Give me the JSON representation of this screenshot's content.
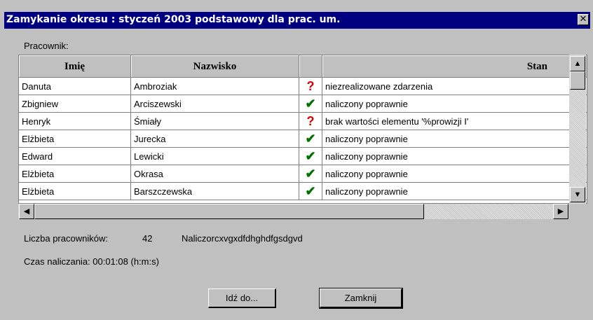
{
  "window": {
    "title": "Zamykanie okresu : styczeń 2003 podstawowy dla prac. um.",
    "close_glyph": "✕"
  },
  "grid_label": "Pracownik:",
  "columns": [
    "Imię",
    "Nazwisko",
    "",
    "Stan"
  ],
  "rows": [
    {
      "imie": "Danuta",
      "nazwisko": "Ambroziak",
      "icon": "?",
      "icon_type": "question-icon",
      "stan": "niezrealizowane zdarzenia"
    },
    {
      "imie": "Zbigniew",
      "nazwisko": "Arciszewski",
      "icon": "✔",
      "icon_type": "check-icon",
      "stan": "naliczony poprawnie"
    },
    {
      "imie": "Henryk",
      "nazwisko": "Śmiały",
      "icon": "?",
      "icon_type": "question-icon",
      "stan": "brak wartości elementu '%prowizji I'"
    },
    {
      "imie": "Elżbieta",
      "nazwisko": "Jurecka",
      "icon": "✔",
      "icon_type": "check-icon",
      "stan": "naliczony poprawnie"
    },
    {
      "imie": "Edward",
      "nazwisko": "Lewicki",
      "icon": "✔",
      "icon_type": "check-icon",
      "stan": "naliczony poprawnie"
    },
    {
      "imie": "Elżbieta",
      "nazwisko": "Okrasa",
      "icon": "✔",
      "icon_type": "check-icon",
      "stan": "naliczony poprawnie"
    },
    {
      "imie": "Elżbieta",
      "nazwisko": "Barszczewska",
      "icon": "✔",
      "icon_type": "check-icon",
      "stan": "naliczony poprawnie"
    }
  ],
  "colors": {
    "question": "#e00000",
    "check": "#007000",
    "titlebar": "#000080"
  },
  "status": {
    "count_label": "Liczba pracowników:",
    "count_value": "42",
    "progress_text": "Naliczorcxvgxdfdhghdfgsdgvd",
    "time_label": "Czas naliczania: 00:01:08 (h:m:s)"
  },
  "buttons": {
    "goto": "Idź do...",
    "close": "Zamknij"
  },
  "scroll": {
    "up": "▲",
    "down": "▼",
    "left": "◀",
    "right": "▶"
  }
}
